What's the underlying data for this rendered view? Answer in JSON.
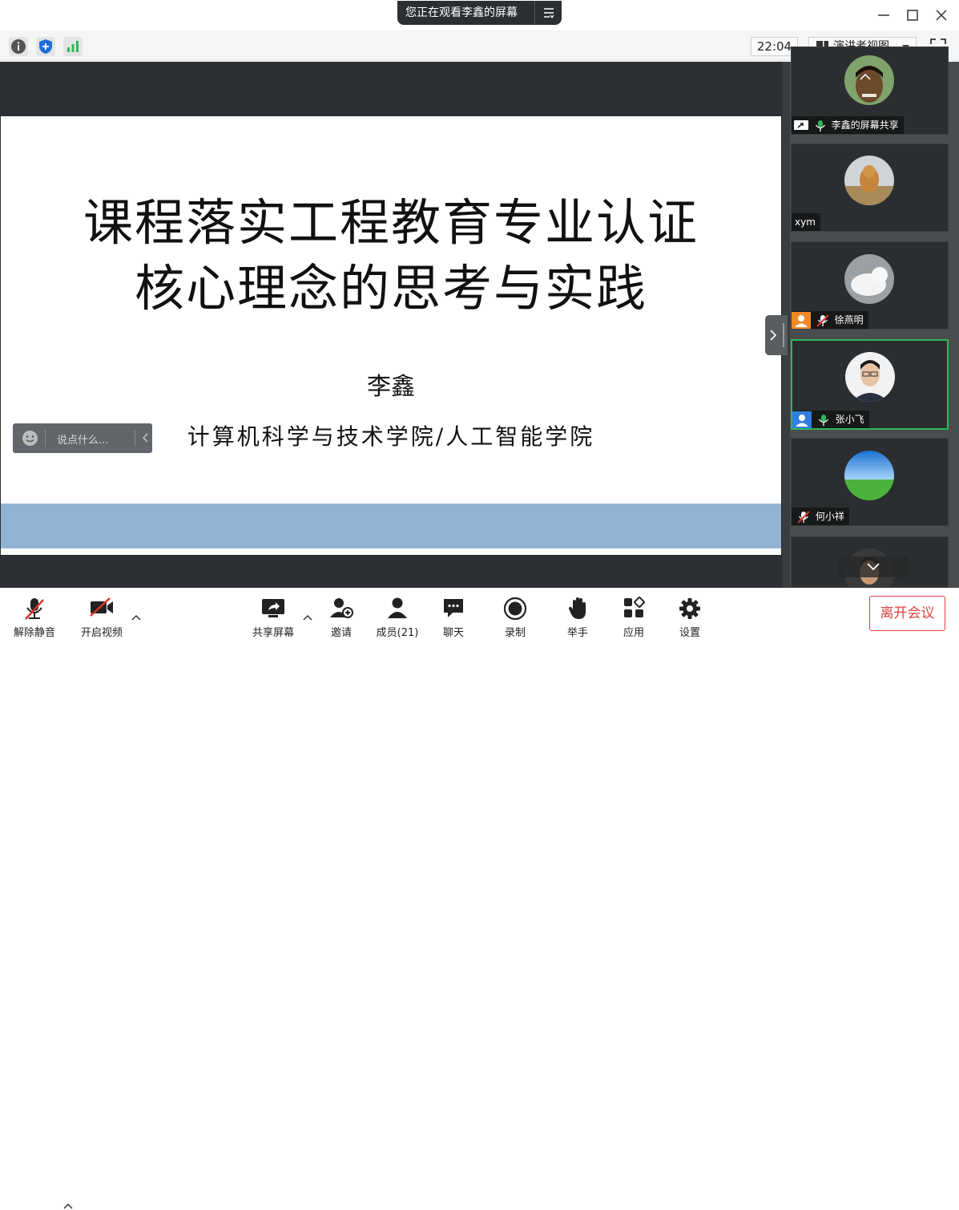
{
  "banner": {
    "text": "您正在观看李鑫的屏幕"
  },
  "infobar": {
    "time": "22:04",
    "view_mode": "演讲者视图"
  },
  "slide": {
    "title_line1": "课程落实工程教育专业认证",
    "title_line2": "核心理念的思考与实践",
    "author": "李鑫",
    "affiliation": "计算机科学与技术学院/人工智能学院",
    "band_color": "#93b3d3"
  },
  "chat": {
    "placeholder": "说点什么..."
  },
  "participants": [
    {
      "name": "李鑫的屏幕共享",
      "mic": "on"
    },
    {
      "name": "xym",
      "mic": "none"
    },
    {
      "name": "徐燕明",
      "mic": "muted"
    },
    {
      "name": "张小飞",
      "mic": "on",
      "active": true
    },
    {
      "name": "何小祥",
      "mic": "muted"
    },
    {
      "name": "",
      "mic": "none"
    }
  ],
  "toolbar": {
    "mute": "解除静音",
    "video": "开启视频",
    "share": "共享屏幕",
    "invite": "邀请",
    "members": "成员(21)",
    "chat": "聊天",
    "record": "录制",
    "raise_hand": "举手",
    "apps": "应用",
    "settings": "设置",
    "leave": "离开会议"
  },
  "colors": {
    "accent_green": "#2fb659",
    "leave_red": "#e04040",
    "mute_red": "#d9342b"
  }
}
